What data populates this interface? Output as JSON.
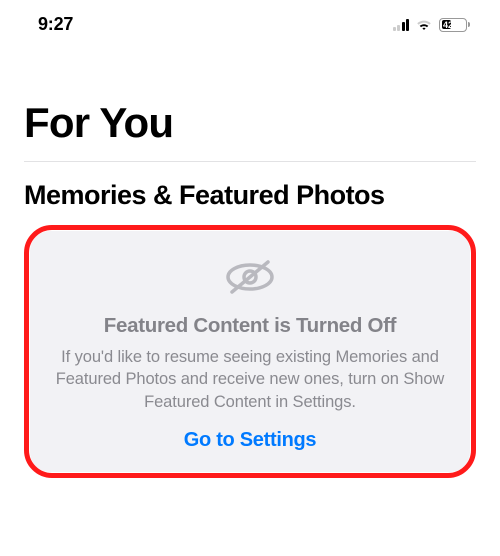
{
  "status_bar": {
    "time": "9:27",
    "battery_pct": "42"
  },
  "page": {
    "title": "For You",
    "section_title": "Memories & Featured Photos"
  },
  "callout": {
    "title": "Featured Content is Turned Off",
    "message": "If you'd like to resume seeing existing Memories and Featured Photos and receive new ones, turn on Show Featured Content in Settings.",
    "link_label": "Go to Settings"
  }
}
